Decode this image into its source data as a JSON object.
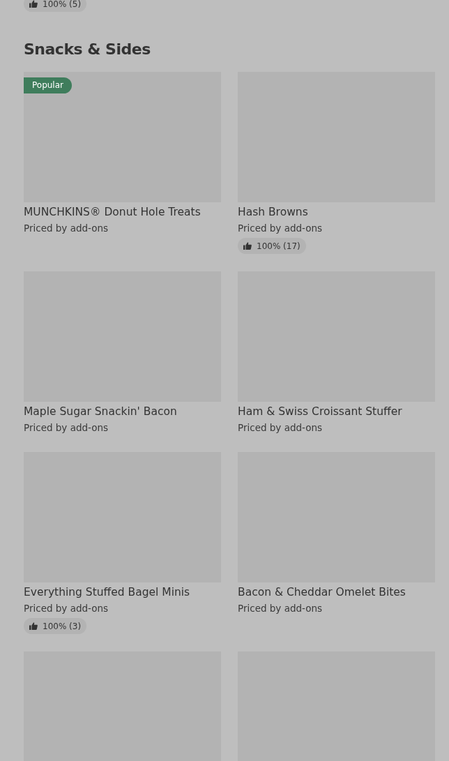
{
  "previous_item_rating": "100% (5)",
  "section": {
    "title": "Snacks & Sides",
    "items": [
      {
        "kind": "full",
        "badge": "Popular",
        "name": "MUNCHKINS® Donut Hole Treats",
        "price": "Priced by add-ons"
      },
      {
        "kind": "full",
        "name": "Hash Browns",
        "price": "Priced by add-ons",
        "rating": "100% (17)"
      },
      {
        "kind": "full",
        "name": "Maple Sugar Snackin' Bacon",
        "price": "Priced by add-ons"
      },
      {
        "kind": "full",
        "name": "Ham & Swiss Croissant Stuffer",
        "price": "Priced by add-ons"
      },
      {
        "kind": "full",
        "name": "Everything Stuffed Bagel Minis",
        "price": "Priced by add-ons",
        "rating": "100% (3)"
      },
      {
        "kind": "full",
        "name": "Bacon & Cheddar Omelet Bites",
        "price": "Priced by add-ons"
      },
      {
        "kind": "image-only"
      },
      {
        "kind": "image-only"
      }
    ]
  }
}
